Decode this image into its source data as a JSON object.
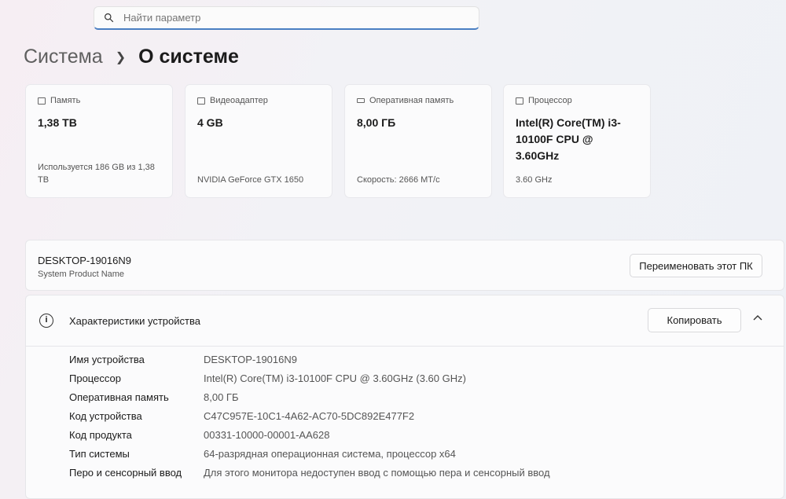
{
  "search": {
    "placeholder": "Найти параметр"
  },
  "breadcrumb": {
    "parent": "Система",
    "current": "О системе"
  },
  "cards": [
    {
      "icon": "storage-icon",
      "title": "Память",
      "value": "1,38 TB",
      "sub": "Используется 186 GB из 1,38 TB"
    },
    {
      "icon": "display-adapter-icon",
      "title": "Видеоадаптер",
      "value": "4 GB",
      "sub": "NVIDIA GeForce GTX 1650"
    },
    {
      "icon": "ram-icon",
      "title": "Оперативная память",
      "value": "8,00 ГБ",
      "sub": "Скорость: 2666 МТ/с"
    },
    {
      "icon": "processor-icon",
      "title": "Процессор",
      "value": "Intel(R) Core(TM) i3-10100F CPU @ 3.60GHz",
      "sub": "3.60 GHz"
    }
  ],
  "pc": {
    "name": "DESKTOP-19016N9",
    "subtitle": "System Product Name",
    "rename_label": "Переименовать этот ПК"
  },
  "specs": {
    "title": "Характеристики устройства",
    "copy_label": "Копировать",
    "rows": [
      {
        "label": "Имя устройства",
        "value": "DESKTOP-19016N9"
      },
      {
        "label": "Процессор",
        "value": "Intel(R) Core(TM) i3-10100F CPU @ 3.60GHz (3.60 GHz)"
      },
      {
        "label": "Оперативная память",
        "value": "8,00 ГБ"
      },
      {
        "label": "Код устройства",
        "value": "C47C957E-10C1-4A62-AC70-5DC892E477F2"
      },
      {
        "label": "Код продукта",
        "value": "00331-10000-00001-AA628"
      },
      {
        "label": "Тип системы",
        "value": "64-разрядная операционная система, процессор x64"
      },
      {
        "label": "Перо и сенсорный ввод",
        "value": "Для этого монитора недоступен ввод с помощью пера и сенсорный ввод"
      }
    ]
  }
}
